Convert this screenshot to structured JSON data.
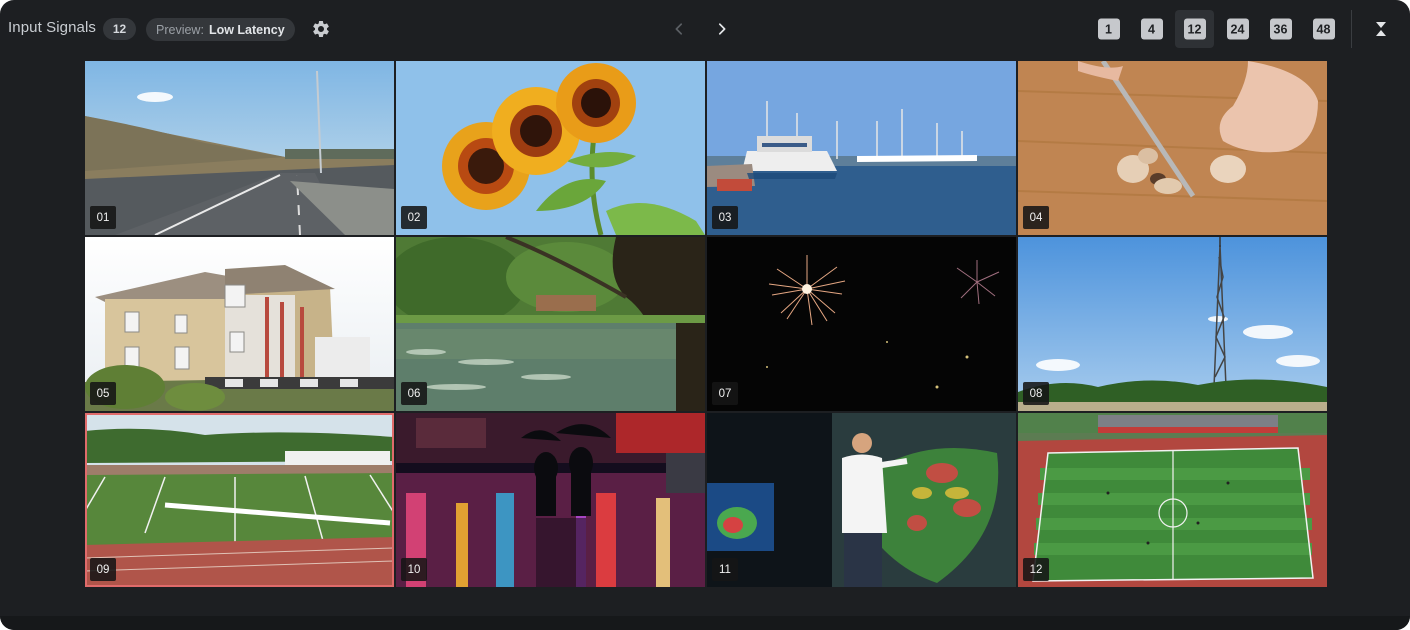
{
  "header": {
    "title": "Input Signals",
    "count": "12",
    "preview_label": "Preview:",
    "preview_value": "Low Latency"
  },
  "icons": {
    "settings": "gear-icon",
    "prev": "chevron-left-icon",
    "next": "chevron-right-icon",
    "collapse": "collapse-icon"
  },
  "layout_options": [
    {
      "label": "1",
      "active": false
    },
    {
      "label": "4",
      "active": false
    },
    {
      "label": "12",
      "active": true
    },
    {
      "label": "24",
      "active": false
    },
    {
      "label": "36",
      "active": false
    },
    {
      "label": "48",
      "active": false
    }
  ],
  "tiles": [
    {
      "number": "01",
      "scene": "highway",
      "selected": false
    },
    {
      "number": "02",
      "scene": "sunflowers",
      "selected": false
    },
    {
      "number": "03",
      "scene": "harbor",
      "selected": false
    },
    {
      "number": "04",
      "scene": "cutting board",
      "selected": false
    },
    {
      "number": "05",
      "scene": "house construction",
      "selected": false
    },
    {
      "number": "06",
      "scene": "pond",
      "selected": false
    },
    {
      "number": "07",
      "scene": "fireworks",
      "selected": false
    },
    {
      "number": "08",
      "scene": "radio tower",
      "selected": false
    },
    {
      "number": "09",
      "scene": "football field",
      "selected": true
    },
    {
      "number": "10",
      "scene": "rainy street",
      "selected": false
    },
    {
      "number": "11",
      "scene": "weather presenter",
      "selected": false
    },
    {
      "number": "12",
      "scene": "soccer stadium",
      "selected": false
    }
  ],
  "colors": {
    "background": "#1d1f22",
    "badge": "#34373b",
    "chip": "#c6c8cc",
    "selection": "#e06b6b"
  }
}
